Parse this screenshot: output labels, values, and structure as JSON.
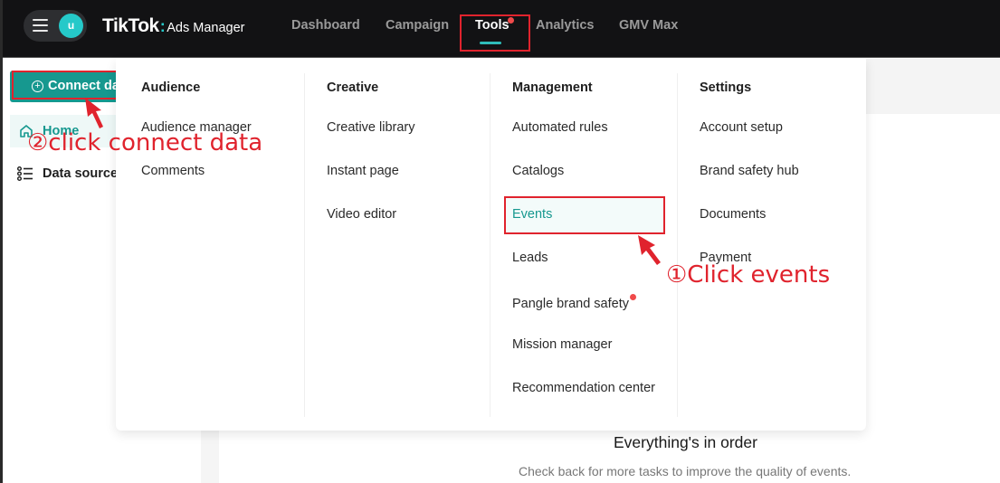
{
  "header": {
    "avatar_initial": "u",
    "logo_brand": "TikTok",
    "logo_colon": ":",
    "logo_product": "Ads Manager",
    "nav": [
      {
        "label": "Dashboard",
        "active": false
      },
      {
        "label": "Campaign",
        "active": false
      },
      {
        "label": "Tools",
        "active": true,
        "badge": "red-dot"
      },
      {
        "label": "Analytics",
        "active": false
      },
      {
        "label": "GMV Max",
        "active": false
      }
    ]
  },
  "sidebar": {
    "connect_button": "Connect data",
    "items": [
      {
        "label": "Home",
        "icon": "home-icon",
        "active": true
      },
      {
        "label": "Data sources",
        "icon": "list-icon",
        "active": false
      }
    ]
  },
  "tools_menu": {
    "columns": [
      {
        "title": "Audience",
        "items": [
          "Audience manager",
          "Comments"
        ]
      },
      {
        "title": "Creative",
        "items": [
          "Creative library",
          "Instant page",
          "Video editor"
        ]
      },
      {
        "title": "Management",
        "items": [
          "Automated rules",
          "Catalogs",
          "Events",
          "Leads",
          "Pangle brand safety",
          "Mission manager",
          "Recommendation center"
        ],
        "active_item": "Events",
        "badged_item": "Pangle brand safety"
      },
      {
        "title": "Settings",
        "items": [
          "Account setup",
          "Brand safety hub",
          "Documents",
          "Payment"
        ]
      }
    ]
  },
  "main": {
    "empty_title": "Everything's in order",
    "empty_subtitle": "Check back for more tasks to improve the quality of events."
  },
  "annotations": {
    "step1": "①Click events",
    "step2": "②click connect data"
  },
  "colors": {
    "accent": "#16988f",
    "topbar": "#121214",
    "annotation": "#e0232d",
    "badge": "#f04a4a",
    "avatar": "#25c9c9"
  }
}
